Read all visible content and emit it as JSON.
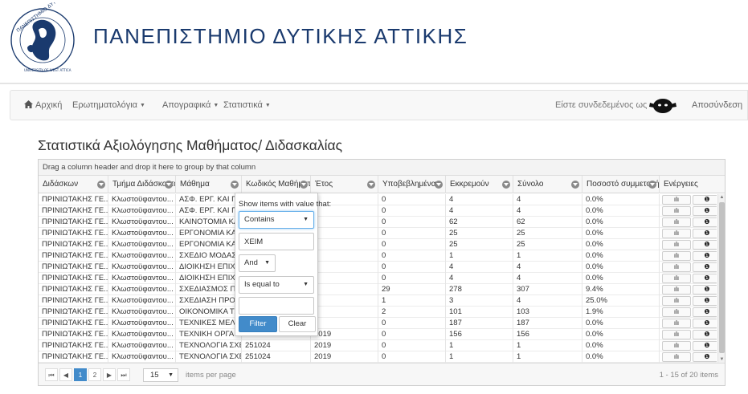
{
  "header": {
    "university_title": "ΠΑΝΕΠΙΣΤΗΜΙΟ ΔΥΤΙΚΗΣ ΑΤΤΙΚΗΣ",
    "logo_text_top": "ΠΑΝΕΠΙΣΤΗΜΙΟ ΔΥΤΙΚΗΣ ΑΤΤΙΚΗΣ",
    "logo_text_bottom": "UNIVERSITY OF WEST ATTICA"
  },
  "navbar": {
    "home": "Αρχική",
    "menu_1": "Ερωτηματολόγια",
    "menu_2": "Απογραφικά",
    "menu_3": "Στατιστικά",
    "logged_in_as": "Είστε συνδεδεμένος ως",
    "logout": "Αποσύνδεση"
  },
  "page": {
    "title": "Στατιστικά Αξιολόγησης Μαθήματος/ Διδασκαλίας"
  },
  "grid": {
    "group_panel_text": "Drag a column header and drop it here to group by that column",
    "columns": [
      "Διδάσκων",
      "Τμήμα Διδάσκοντα",
      "Μάθημα",
      "Κωδικός Μαθήματος",
      "Έτος",
      "Υποβεβλημένα",
      "Εκκρεμούν",
      "Σύνολο",
      "Ποσοστό συμμετοχής",
      "Ενέργειες"
    ],
    "rows": [
      [
        "ΠΡΙΝΙΩΤΑΚΗΣ ΓΕ...",
        "Κλωστοϋφαντου...",
        "ΑΣΦ. ΕΡΓ. ΚΑΙ ΠΡ...",
        "",
        "",
        "0",
        "4",
        "4",
        "0.0%"
      ],
      [
        "ΠΡΙΝΙΩΤΑΚΗΣ ΓΕ...",
        "Κλωστοϋφαντου...",
        "ΑΣΦ. ΕΡΓ. ΚΑΙ ΠΡ...",
        "",
        "",
        "0",
        "4",
        "4",
        "0.0%"
      ],
      [
        "ΠΡΙΝΙΩΤΑΚΗΣ ΓΕ...",
        "Κλωστοϋφαντου...",
        "ΚΑΙΝΟΤΟΜΙΑ ΚΑΙ...",
        "",
        "",
        "0",
        "62",
        "62",
        "0.0%"
      ],
      [
        "ΠΡΙΝΙΩΤΑΚΗΣ ΓΕ...",
        "Κλωστοϋφαντου...",
        "ΕΡΓΟΝΟΜΙΑ ΚΑΙ...",
        "",
        "",
        "0",
        "25",
        "25",
        "0.0%"
      ],
      [
        "ΠΡΙΝΙΩΤΑΚΗΣ ΓΕ...",
        "Κλωστοϋφαντου...",
        "ΕΡΓΟΝΟΜΙΑ ΚΑΙ...",
        "",
        "",
        "0",
        "25",
        "25",
        "0.0%"
      ],
      [
        "ΠΡΙΝΙΩΤΑΚΗΣ ΓΕ...",
        "Κλωστοϋφαντου...",
        "ΣΧΕΔΙΟ ΜΟΔΑΣ -...",
        "",
        "",
        "0",
        "1",
        "1",
        "0.0%"
      ],
      [
        "ΠΡΙΝΙΩΤΑΚΗΣ ΓΕ...",
        "Κλωστοϋφαντου...",
        "ΔΙΟΙΚΗΣΗ ΕΠΙΧΕΙ...",
        "",
        "",
        "0",
        "4",
        "4",
        "0.0%"
      ],
      [
        "ΠΡΙΝΙΩΤΑΚΗΣ ΓΕ...",
        "Κλωστοϋφαντου...",
        "ΔΙΟΙΚΗΣΗ ΕΠΙΧΕΙ...",
        "",
        "",
        "0",
        "4",
        "4",
        "0.0%"
      ],
      [
        "ΠΡΙΝΙΩΤΑΚΗΣ ΓΕ...",
        "Κλωστοϋφαντου...",
        "ΣΧΕΔΙΑΣΜΟΣ ΠΑ...",
        "",
        "",
        "29",
        "278",
        "307",
        "9.4%"
      ],
      [
        "ΠΡΙΝΙΩΤΑΚΗΣ ΓΕ...",
        "Κλωστοϋφαντου...",
        "ΣΧΕΔΙΑΣΗ ΠΡΟΪΟ...",
        "",
        "",
        "1",
        "3",
        "4",
        "25.0%"
      ],
      [
        "ΠΡΙΝΙΩΤΑΚΗΣ ΓΕ...",
        "Κλωστοϋφαντου...",
        "ΟΙΚΟΝΟΜΙΚΑ ΤΩ...",
        "",
        "",
        "2",
        "101",
        "103",
        "1.9%"
      ],
      [
        "ΠΡΙΝΙΩΤΑΚΗΣ ΓΕ...",
        "Κλωστοϋφαντου...",
        "ΤΕΧΝΙΚΕΣ ΜΕΛΕΤ...",
        "",
        "",
        "0",
        "187",
        "187",
        "0.0%"
      ],
      [
        "ΠΡΙΝΙΩΤΑΚΗΣ ΓΕ...",
        "Κλωστοϋφαντου...",
        "ΤΕΧΝΙΚΗ ΟΡΓΑΝ...",
        "",
        "2019",
        "0",
        "156",
        "156",
        "0.0%"
      ],
      [
        "ΠΡΙΝΙΩΤΑΚΗΣ ΓΕ...",
        "Κλωστοϋφαντου...",
        "ΤΕΧΝΟΛΟΓΙΑ ΣΧΕ...",
        "251024",
        "2019",
        "0",
        "1",
        "1",
        "0.0%"
      ],
      [
        "ΠΡΙΝΙΩΤΑΚΗΣ ΓΕ...",
        "Κλωστοϋφαντου...",
        "ΤΕΧΝΟΛΟΓΙΑ ΣΧΕ...",
        "251024",
        "2019",
        "0",
        "1",
        "1",
        "0.0%"
      ]
    ],
    "action_icons": [
      "bar-chart-icon",
      "info-icon"
    ],
    "action_glyphs": [
      "ılı",
      "❶"
    ]
  },
  "pager": {
    "first": "⏮",
    "prev": "◀",
    "pages": [
      "1",
      "2"
    ],
    "current_page": "1",
    "next": "▶",
    "last": "⏭",
    "page_size": "15",
    "items_per_page": "items per page",
    "info": "1 - 15 of 20 items"
  },
  "filter_popup": {
    "title": "Show items with value that:",
    "operator_1": "Contains",
    "value_1": "ΧΕΙΜ",
    "logic": "And",
    "operator_2": "Is equal to",
    "value_2": "",
    "filter_button": "Filter",
    "clear_button": "Clear"
  },
  "colors": {
    "brand_blue": "#1a3a6e",
    "primary_button": "#428bca"
  }
}
